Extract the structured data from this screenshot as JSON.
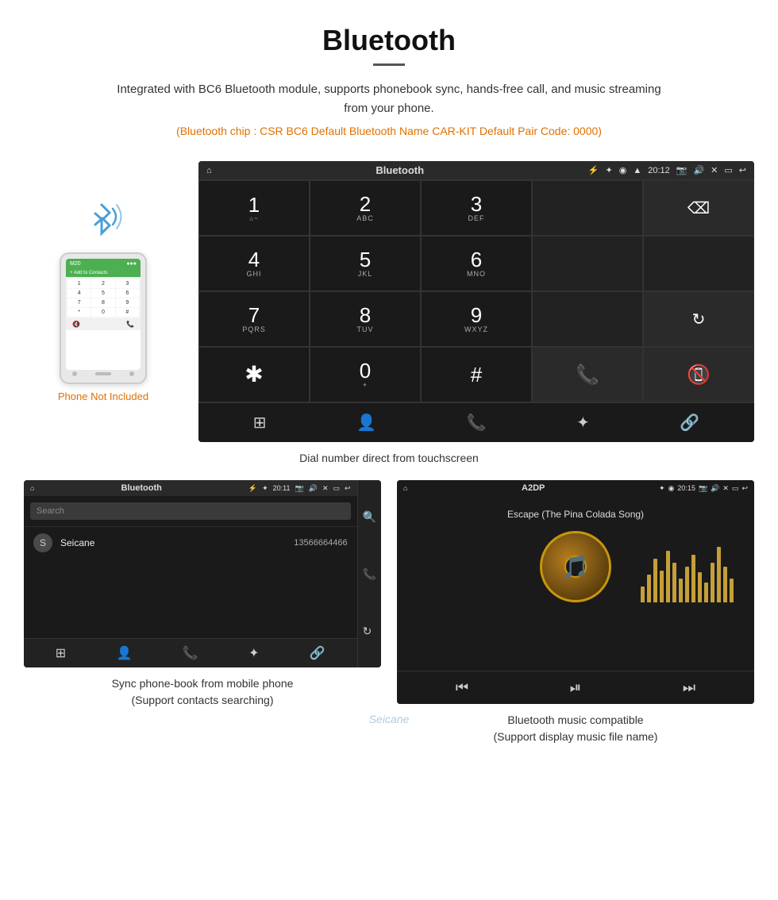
{
  "header": {
    "title": "Bluetooth",
    "description": "Integrated with BC6 Bluetooth module, supports phonebook sync, hands-free call, and music streaming from your phone.",
    "specs": "(Bluetooth chip : CSR BC6    Default Bluetooth Name CAR-KIT    Default Pair Code: 0000)"
  },
  "phone_label": "Phone Not Included",
  "android_dial": {
    "status_title": "Bluetooth",
    "time": "20:12",
    "keys": [
      {
        "num": "1",
        "sub": ""
      },
      {
        "num": "2",
        "sub": "ABC"
      },
      {
        "num": "3",
        "sub": "DEF"
      },
      {
        "num": "4",
        "sub": "GHI"
      },
      {
        "num": "5",
        "sub": "JKL"
      },
      {
        "num": "6",
        "sub": "MNO"
      },
      {
        "num": "7",
        "sub": "PQRS"
      },
      {
        "num": "8",
        "sub": "TUV"
      },
      {
        "num": "9",
        "sub": "WXYZ"
      },
      {
        "num": "*",
        "sub": ""
      },
      {
        "num": "0",
        "sub": "+"
      },
      {
        "num": "#",
        "sub": ""
      }
    ]
  },
  "dial_caption": "Dial number direct from touchscreen",
  "phonebook": {
    "title": "Bluetooth",
    "time": "20:11",
    "search_placeholder": "Search",
    "contact_initial": "S",
    "contact_name": "Seicane",
    "contact_number": "13566664466"
  },
  "phonebook_caption_line1": "Sync phone-book from mobile phone",
  "phonebook_caption_line2": "(Support contacts searching)",
  "a2dp": {
    "title": "A2DP",
    "time": "20:15",
    "song_name": "Escape (The Pina Colada Song)"
  },
  "a2dp_caption_line1": "Bluetooth music compatible",
  "a2dp_caption_line2": "(Support display music file name)",
  "seicane_watermark": "Seicane",
  "eq_heights": [
    20,
    35,
    55,
    40,
    65,
    50,
    30,
    45,
    60,
    38,
    25,
    50,
    70,
    45,
    30
  ]
}
